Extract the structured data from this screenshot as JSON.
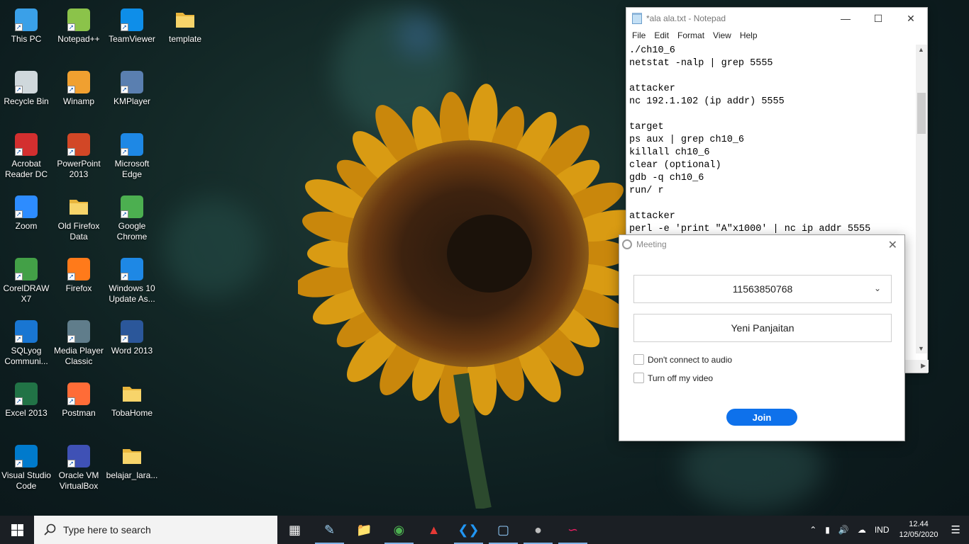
{
  "desktop": {
    "icons": [
      {
        "label": "This PC",
        "icon": "this-pc-icon"
      },
      {
        "label": "Notepad++",
        "icon": "notepadpp-icon"
      },
      {
        "label": "TeamViewer",
        "icon": "teamviewer-icon"
      },
      {
        "label": "template",
        "icon": "folder-icon"
      },
      {
        "label": "Recycle Bin",
        "icon": "recycle-bin-icon"
      },
      {
        "label": "Winamp",
        "icon": "winamp-icon"
      },
      {
        "label": "KMPlayer",
        "icon": "kmplayer-icon"
      },
      {
        "label": "Acrobat Reader DC",
        "icon": "acrobat-icon"
      },
      {
        "label": "PowerPoint 2013",
        "icon": "powerpoint-icon"
      },
      {
        "label": "Microsoft Edge",
        "icon": "edge-icon"
      },
      {
        "label": "Zoom",
        "icon": "zoom-icon"
      },
      {
        "label": "Old Firefox Data",
        "icon": "folder-icon"
      },
      {
        "label": "Google Chrome",
        "icon": "chrome-icon"
      },
      {
        "label": "CorelDRAW X7",
        "icon": "coreldraw-icon"
      },
      {
        "label": "Firefox",
        "icon": "firefox-icon"
      },
      {
        "label": "Windows 10 Update As...",
        "icon": "windows-update-icon"
      },
      {
        "label": "SQLyog Communi...",
        "icon": "sqlyog-icon"
      },
      {
        "label": "Media Player Classic",
        "icon": "media-player-icon"
      },
      {
        "label": "Word 2013",
        "icon": "word-icon"
      },
      {
        "label": "Excel 2013",
        "icon": "excel-icon"
      },
      {
        "label": "Postman",
        "icon": "postman-icon"
      },
      {
        "label": "TobaHome",
        "icon": "folder-icon"
      },
      {
        "label": "Visual Studio Code",
        "icon": "vscode-icon"
      },
      {
        "label": "Oracle VM VirtualBox",
        "icon": "virtualbox-icon"
      },
      {
        "label": "belajar_lara...",
        "icon": "folder-icon"
      }
    ]
  },
  "notepad": {
    "title": "*ala ala.txt - Notepad",
    "menu": [
      "File",
      "Edit",
      "Format",
      "View",
      "Help"
    ],
    "lines": [
      "./ch10_6",
      "netstat -nalp | grep 5555",
      "",
      "attacker",
      "nc 192.1.102 (ip addr) 5555",
      "",
      "target",
      "ps aux | grep ch10_6",
      "killall ch10_6",
      "clear (optional)",
      "gdb -q ch10_6",
      "run/ r",
      "",
      "attacker",
      "perl -e 'print \"A\"x1000' | nc ip addr 5555"
    ]
  },
  "meeting": {
    "title": "Meeting",
    "meeting_id": "11563850768",
    "name_value": "Yeni Panjaitan",
    "options": [
      "Don't connect to audio",
      "Turn off my video"
    ],
    "join_label": "Join"
  },
  "taskbar": {
    "search_placeholder": "Type here to search",
    "apps": [
      "task-view-icon",
      "notepad-icon",
      "file-explorer-icon",
      "chrome-icon",
      "acrobat-icon",
      "vscode-icon",
      "virtualbox-icon",
      "zoom-icon",
      "debian-icon"
    ],
    "language": "IND",
    "time": "12.44",
    "date": "12/05/2020"
  }
}
